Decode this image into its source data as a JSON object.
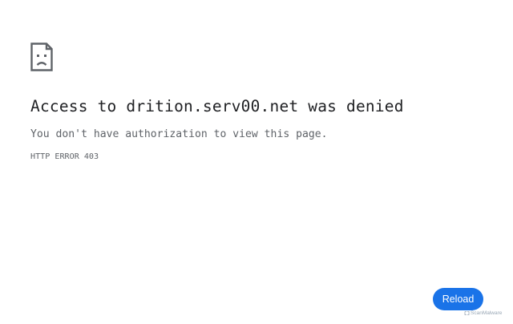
{
  "error": {
    "icon": "sad-page-icon",
    "title": "Access to drition.serv00.net was denied",
    "message": "You don't have authorization to view this page.",
    "code": "HTTP ERROR 403"
  },
  "actions": {
    "reload_label": "Reload"
  },
  "watermark": {
    "icon": "scan-malware-logo-icon",
    "text": "ScanMalware"
  },
  "colors": {
    "accent": "#1a73e8",
    "title_text": "#202124",
    "secondary_text": "#5f6368"
  }
}
